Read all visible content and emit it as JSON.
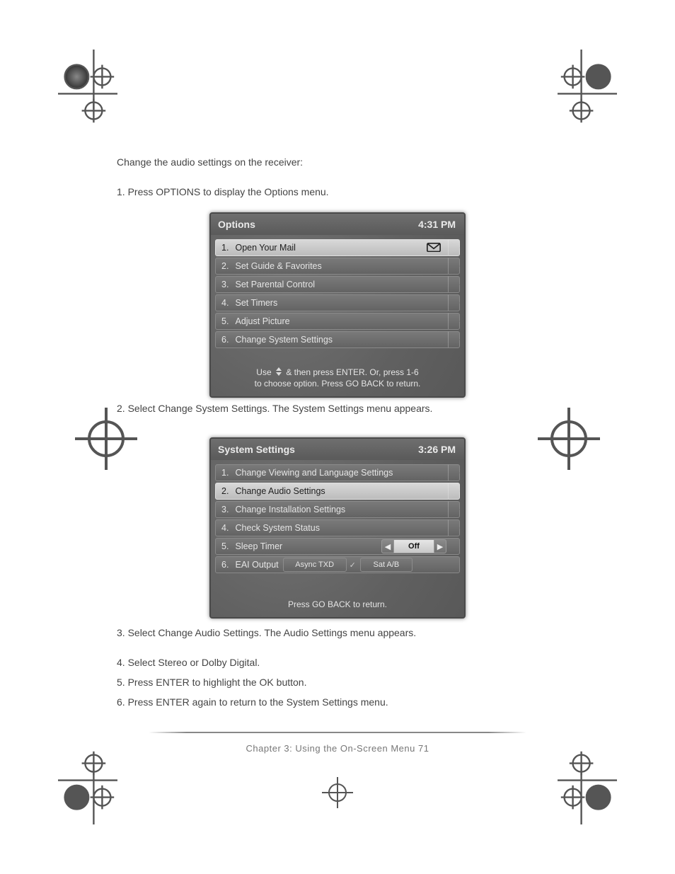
{
  "body_text": {
    "para1": "Change the audio settings on the receiver:",
    "para2": "1.   Press OPTIONS to display the Options menu.",
    "step3": "3.   Select Change Audio Settings. The Audio Settings menu appears.",
    "step4": "4.   Select Stereo or Dolby Digital.",
    "step5": "5.   Press ENTER to highlight the OK button.",
    "step6": "6.   Press ENTER again to return to the System Settings menu."
  },
  "panel1": {
    "title": "Options",
    "clock": "4:31 PM",
    "rows": [
      {
        "num": "1.",
        "label": "Open Your Mail",
        "selected": true,
        "mail_icon": true
      },
      {
        "num": "2.",
        "label": "Set Guide & Favorites"
      },
      {
        "num": "3.",
        "label": "Set Parental Control"
      },
      {
        "num": "4.",
        "label": "Set Timers"
      },
      {
        "num": "5.",
        "label": "Adjust Picture"
      },
      {
        "num": "6.",
        "label": "Change System Settings"
      }
    ],
    "footer_line1": "Use     & then press ENTER. Or, press 1-6",
    "footer_line2": "to choose option.  Press GO BACK to return."
  },
  "panel2": {
    "title": "System Settings",
    "clock": "3:26 PM",
    "rows": [
      {
        "num": "1.",
        "label": "Change Viewing and Language Settings"
      },
      {
        "num": "2.",
        "label": "Change Audio Settings",
        "selected": true
      },
      {
        "num": "3.",
        "label": "Change Installation Settings"
      },
      {
        "num": "4.",
        "label": "Check System Status"
      },
      {
        "num": "5.",
        "label": "Sleep Timer",
        "sleep_value": "Off"
      },
      {
        "num": "6.",
        "label": "EAI Output",
        "eai_mode": "Async TXD",
        "eai_sat": "Sat A/B"
      }
    ],
    "footer": "Press GO BACK to return."
  },
  "footer_label": "Chapter 3: Using the On-Screen Menu    71",
  "intermediate_step": "2.   Select Change System Settings. The System Settings menu appears."
}
